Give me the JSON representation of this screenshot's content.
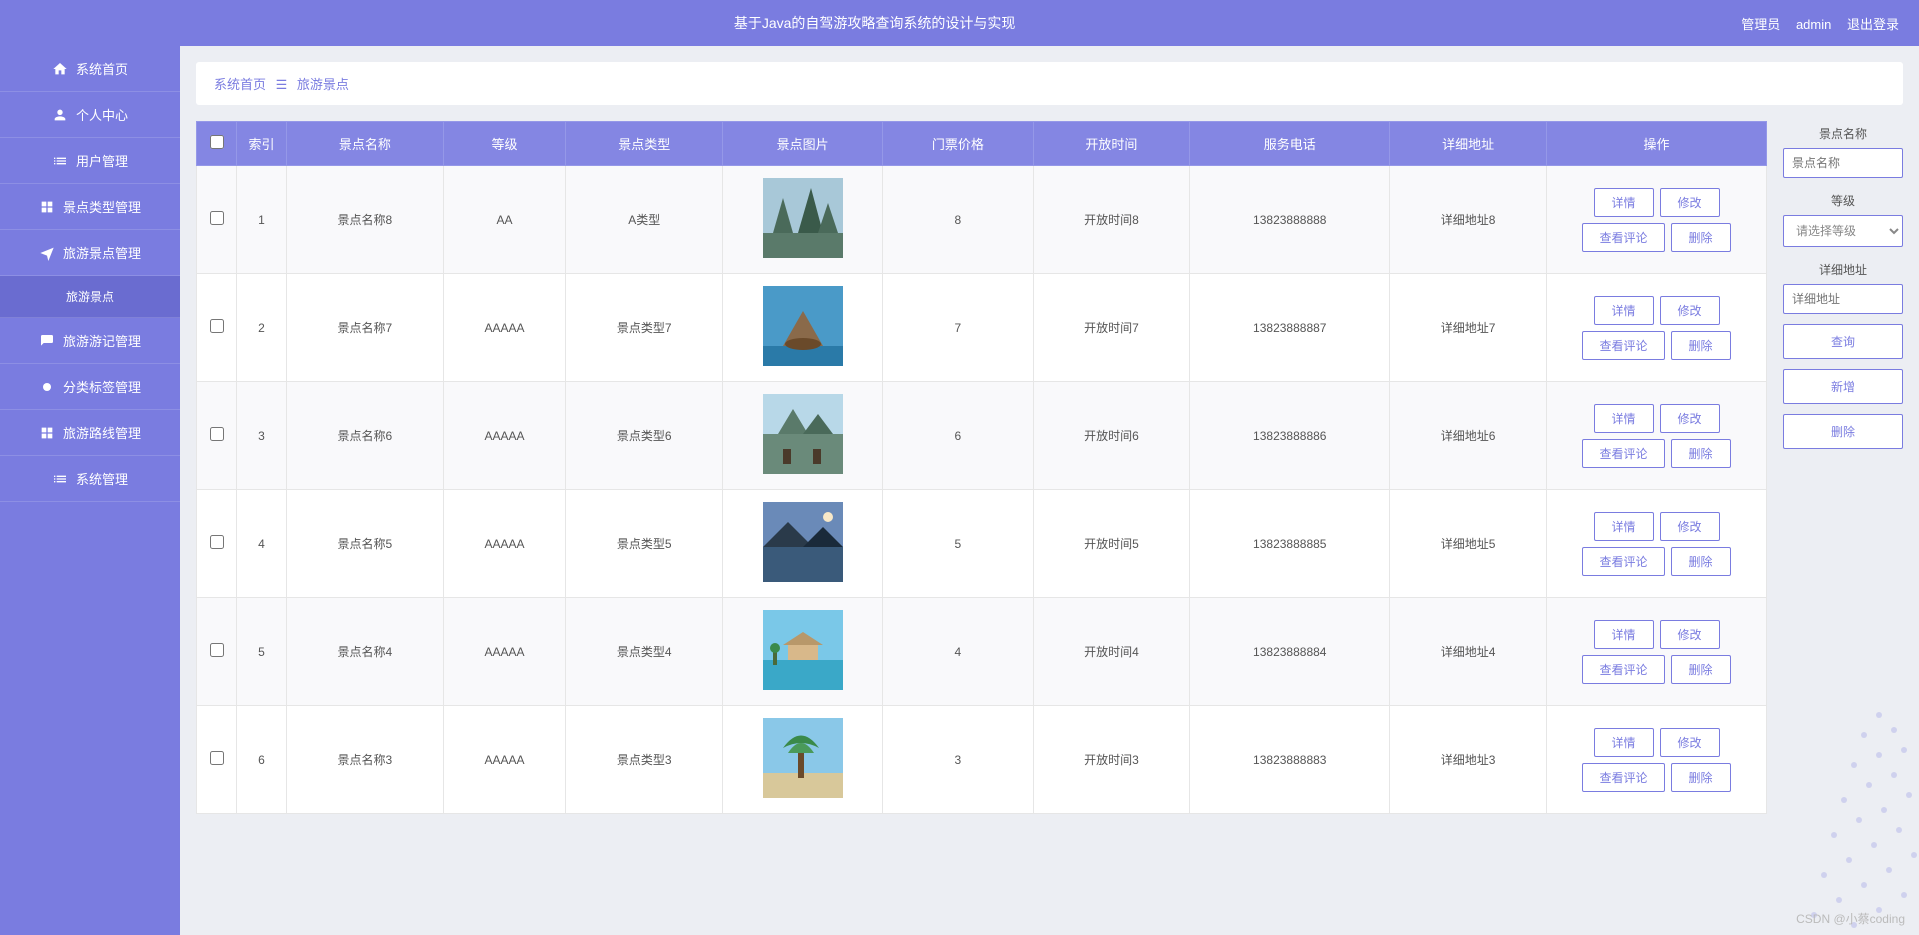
{
  "header": {
    "title": "基于Java的自驾游攻略查询系统的设计与实现",
    "role": "管理员",
    "username": "admin",
    "logout": "退出登录"
  },
  "sidebar": {
    "items": [
      {
        "icon": "home",
        "label": "系统首页"
      },
      {
        "icon": "user",
        "label": "个人中心"
      },
      {
        "icon": "list",
        "label": "用户管理"
      },
      {
        "icon": "grid",
        "label": "景点类型管理"
      },
      {
        "icon": "plane",
        "label": "旅游景点管理"
      },
      {
        "icon": "sub",
        "label": "旅游景点",
        "sub": true
      },
      {
        "icon": "note",
        "label": "旅游游记管理"
      },
      {
        "icon": "tag",
        "label": "分类标签管理"
      },
      {
        "icon": "route",
        "label": "旅游路线管理"
      },
      {
        "icon": "gear",
        "label": "系统管理"
      }
    ]
  },
  "breadcrumb": {
    "home": "系统首页",
    "current": "旅游景点"
  },
  "table": {
    "headers": [
      "",
      "索引",
      "景点名称",
      "等级",
      "景点类型",
      "景点图片",
      "门票价格",
      "开放时间",
      "服务电话",
      "详细地址",
      "操作"
    ],
    "rows": [
      {
        "idx": "1",
        "name": "景点名称8",
        "level": "AA",
        "type": "A类型",
        "price": "8",
        "time": "开放时间8",
        "phone": "13823888888",
        "addr": "详细地址8"
      },
      {
        "idx": "2",
        "name": "景点名称7",
        "level": "AAAAA",
        "type": "景点类型7",
        "price": "7",
        "time": "开放时间7",
        "phone": "13823888887",
        "addr": "详细地址7"
      },
      {
        "idx": "3",
        "name": "景点名称6",
        "level": "AAAAA",
        "type": "景点类型6",
        "price": "6",
        "time": "开放时间6",
        "phone": "13823888886",
        "addr": "详细地址6"
      },
      {
        "idx": "4",
        "name": "景点名称5",
        "level": "AAAAA",
        "type": "景点类型5",
        "price": "5",
        "time": "开放时间5",
        "phone": "13823888885",
        "addr": "详细地址5"
      },
      {
        "idx": "5",
        "name": "景点名称4",
        "level": "AAAAA",
        "type": "景点类型4",
        "price": "4",
        "time": "开放时间4",
        "phone": "13823888884",
        "addr": "详细地址4"
      },
      {
        "idx": "6",
        "name": "景点名称3",
        "level": "AAAAA",
        "type": "景点类型3",
        "price": "3",
        "time": "开放时间3",
        "phone": "13823888883",
        "addr": "详细地址3"
      }
    ],
    "ops": {
      "detail": "详情",
      "edit": "修改",
      "comment": "查看评论",
      "delete": "删除"
    }
  },
  "filter": {
    "name_label": "景点名称",
    "name_placeholder": "景点名称",
    "level_label": "等级",
    "level_placeholder": "请选择等级",
    "addr_label": "详细地址",
    "addr_placeholder": "详细地址",
    "search": "查询",
    "add": "新增",
    "delete": "删除"
  },
  "watermark": "CSDN @小蔡coding"
}
